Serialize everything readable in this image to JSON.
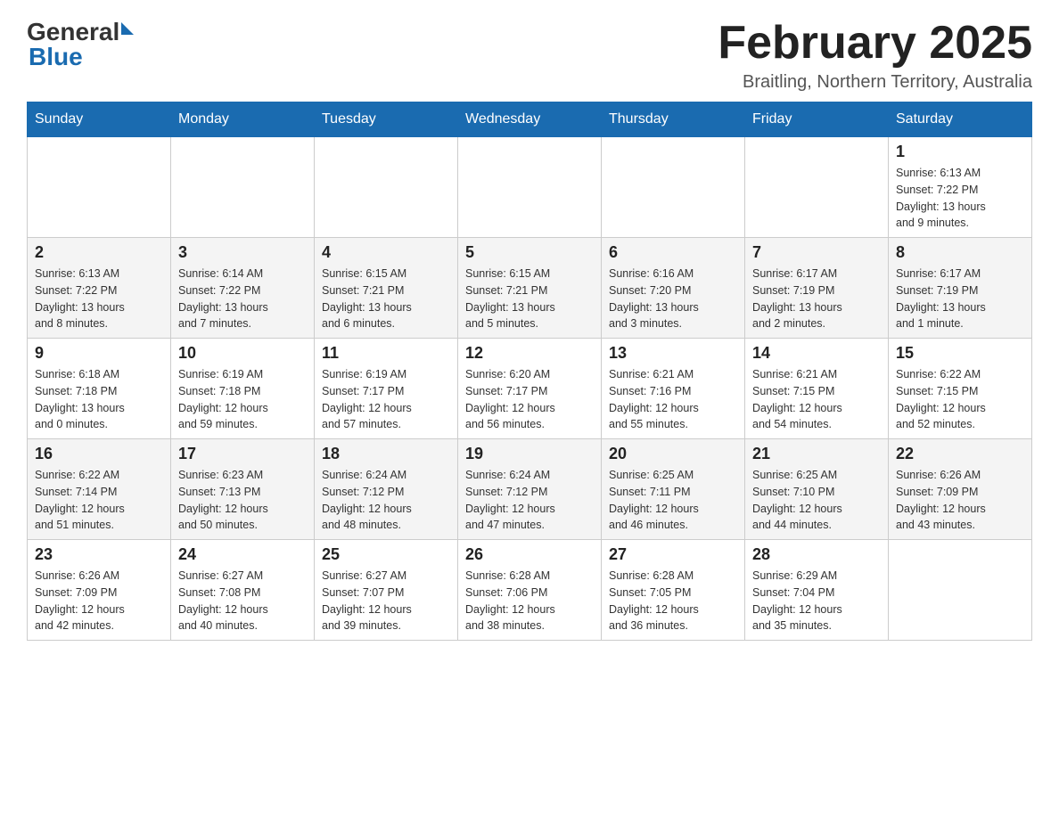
{
  "header": {
    "logo_general": "General",
    "logo_blue": "Blue",
    "month_title": "February 2025",
    "location": "Braitling, Northern Territory, Australia"
  },
  "weekdays": [
    "Sunday",
    "Monday",
    "Tuesday",
    "Wednesday",
    "Thursday",
    "Friday",
    "Saturday"
  ],
  "weeks": [
    [
      {
        "day": "",
        "info": ""
      },
      {
        "day": "",
        "info": ""
      },
      {
        "day": "",
        "info": ""
      },
      {
        "day": "",
        "info": ""
      },
      {
        "day": "",
        "info": ""
      },
      {
        "day": "",
        "info": ""
      },
      {
        "day": "1",
        "info": "Sunrise: 6:13 AM\nSunset: 7:22 PM\nDaylight: 13 hours\nand 9 minutes."
      }
    ],
    [
      {
        "day": "2",
        "info": "Sunrise: 6:13 AM\nSunset: 7:22 PM\nDaylight: 13 hours\nand 8 minutes."
      },
      {
        "day": "3",
        "info": "Sunrise: 6:14 AM\nSunset: 7:22 PM\nDaylight: 13 hours\nand 7 minutes."
      },
      {
        "day": "4",
        "info": "Sunrise: 6:15 AM\nSunset: 7:21 PM\nDaylight: 13 hours\nand 6 minutes."
      },
      {
        "day": "5",
        "info": "Sunrise: 6:15 AM\nSunset: 7:21 PM\nDaylight: 13 hours\nand 5 minutes."
      },
      {
        "day": "6",
        "info": "Sunrise: 6:16 AM\nSunset: 7:20 PM\nDaylight: 13 hours\nand 3 minutes."
      },
      {
        "day": "7",
        "info": "Sunrise: 6:17 AM\nSunset: 7:19 PM\nDaylight: 13 hours\nand 2 minutes."
      },
      {
        "day": "8",
        "info": "Sunrise: 6:17 AM\nSunset: 7:19 PM\nDaylight: 13 hours\nand 1 minute."
      }
    ],
    [
      {
        "day": "9",
        "info": "Sunrise: 6:18 AM\nSunset: 7:18 PM\nDaylight: 13 hours\nand 0 minutes."
      },
      {
        "day": "10",
        "info": "Sunrise: 6:19 AM\nSunset: 7:18 PM\nDaylight: 12 hours\nand 59 minutes."
      },
      {
        "day": "11",
        "info": "Sunrise: 6:19 AM\nSunset: 7:17 PM\nDaylight: 12 hours\nand 57 minutes."
      },
      {
        "day": "12",
        "info": "Sunrise: 6:20 AM\nSunset: 7:17 PM\nDaylight: 12 hours\nand 56 minutes."
      },
      {
        "day": "13",
        "info": "Sunrise: 6:21 AM\nSunset: 7:16 PM\nDaylight: 12 hours\nand 55 minutes."
      },
      {
        "day": "14",
        "info": "Sunrise: 6:21 AM\nSunset: 7:15 PM\nDaylight: 12 hours\nand 54 minutes."
      },
      {
        "day": "15",
        "info": "Sunrise: 6:22 AM\nSunset: 7:15 PM\nDaylight: 12 hours\nand 52 minutes."
      }
    ],
    [
      {
        "day": "16",
        "info": "Sunrise: 6:22 AM\nSunset: 7:14 PM\nDaylight: 12 hours\nand 51 minutes."
      },
      {
        "day": "17",
        "info": "Sunrise: 6:23 AM\nSunset: 7:13 PM\nDaylight: 12 hours\nand 50 minutes."
      },
      {
        "day": "18",
        "info": "Sunrise: 6:24 AM\nSunset: 7:12 PM\nDaylight: 12 hours\nand 48 minutes."
      },
      {
        "day": "19",
        "info": "Sunrise: 6:24 AM\nSunset: 7:12 PM\nDaylight: 12 hours\nand 47 minutes."
      },
      {
        "day": "20",
        "info": "Sunrise: 6:25 AM\nSunset: 7:11 PM\nDaylight: 12 hours\nand 46 minutes."
      },
      {
        "day": "21",
        "info": "Sunrise: 6:25 AM\nSunset: 7:10 PM\nDaylight: 12 hours\nand 44 minutes."
      },
      {
        "day": "22",
        "info": "Sunrise: 6:26 AM\nSunset: 7:09 PM\nDaylight: 12 hours\nand 43 minutes."
      }
    ],
    [
      {
        "day": "23",
        "info": "Sunrise: 6:26 AM\nSunset: 7:09 PM\nDaylight: 12 hours\nand 42 minutes."
      },
      {
        "day": "24",
        "info": "Sunrise: 6:27 AM\nSunset: 7:08 PM\nDaylight: 12 hours\nand 40 minutes."
      },
      {
        "day": "25",
        "info": "Sunrise: 6:27 AM\nSunset: 7:07 PM\nDaylight: 12 hours\nand 39 minutes."
      },
      {
        "day": "26",
        "info": "Sunrise: 6:28 AM\nSunset: 7:06 PM\nDaylight: 12 hours\nand 38 minutes."
      },
      {
        "day": "27",
        "info": "Sunrise: 6:28 AM\nSunset: 7:05 PM\nDaylight: 12 hours\nand 36 minutes."
      },
      {
        "day": "28",
        "info": "Sunrise: 6:29 AM\nSunset: 7:04 PM\nDaylight: 12 hours\nand 35 minutes."
      },
      {
        "day": "",
        "info": ""
      }
    ]
  ]
}
